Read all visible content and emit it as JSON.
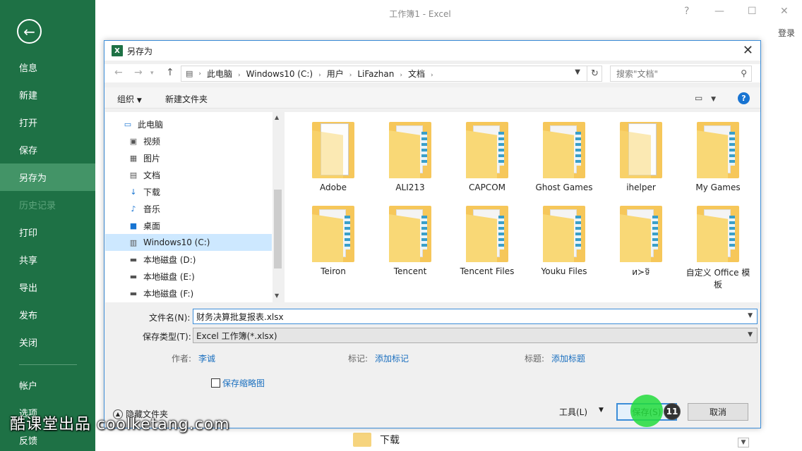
{
  "backstage": {
    "nav": [
      {
        "label": "信息",
        "state": "normal"
      },
      {
        "label": "新建",
        "state": "normal"
      },
      {
        "label": "打开",
        "state": "normal"
      },
      {
        "label": "保存",
        "state": "normal"
      },
      {
        "label": "另存为",
        "state": "active"
      },
      {
        "label": "历史记录",
        "state": "disabled"
      },
      {
        "label": "打印",
        "state": "normal"
      },
      {
        "label": "共享",
        "state": "normal"
      },
      {
        "label": "导出",
        "state": "normal"
      },
      {
        "label": "发布",
        "state": "normal"
      },
      {
        "label": "关闭",
        "state": "normal"
      },
      {
        "label": "帐户",
        "state": "normal"
      },
      {
        "label": "选项",
        "state": "normal"
      },
      {
        "label": "反馈",
        "state": "normal"
      }
    ],
    "window_title": "工作簿1 - Excel",
    "signin": "登录",
    "bg_folder_label": "下载"
  },
  "dialog": {
    "title": "另存为",
    "breadcrumb": [
      "此电脑",
      "Windows10 (C:)",
      "用户",
      "LiFazhan",
      "文档"
    ],
    "search_placeholder": "搜索\"文档\"",
    "toolbar": {
      "organize": "组织",
      "new_folder": "新建文件夹"
    },
    "nav_tree": [
      {
        "label": "此电脑",
        "icon": "computer-icon",
        "selected": false
      },
      {
        "label": "视频",
        "icon": "video-icon",
        "selected": false
      },
      {
        "label": "图片",
        "icon": "picture-icon",
        "selected": false
      },
      {
        "label": "文档",
        "icon": "document-icon",
        "selected": false
      },
      {
        "label": "下载",
        "icon": "download-icon",
        "selected": false
      },
      {
        "label": "音乐",
        "icon": "music-icon",
        "selected": false
      },
      {
        "label": "桌面",
        "icon": "desktop-icon",
        "selected": false
      },
      {
        "label": "Windows10 (C:)",
        "icon": "drive-icon",
        "selected": true
      },
      {
        "label": "本地磁盘 (D:)",
        "icon": "disk-icon",
        "selected": false
      },
      {
        "label": "本地磁盘 (E:)",
        "icon": "disk-icon",
        "selected": false
      },
      {
        "label": "本地磁盘 (F:)",
        "icon": "disk-icon",
        "selected": false
      }
    ],
    "files": [
      {
        "name": "Adobe",
        "type": "folder-doc"
      },
      {
        "name": "ALI213",
        "type": "folder"
      },
      {
        "name": "CAPCOM",
        "type": "folder"
      },
      {
        "name": "Ghost Games",
        "type": "folder"
      },
      {
        "name": "ihelper",
        "type": "folder-doc"
      },
      {
        "name": "My Games",
        "type": "folder"
      },
      {
        "name": "Teiron",
        "type": "folder"
      },
      {
        "name": "Tencent",
        "type": "folder"
      },
      {
        "name": "Tencent Files",
        "type": "folder"
      },
      {
        "name": "Youku Files",
        "type": "folder"
      },
      {
        "name": "и≻ទ៊",
        "type": "folder"
      },
      {
        "name": "自定义 Office 模板",
        "type": "folder"
      }
    ],
    "filename_label": "文件名(N):",
    "filename_value": "财务决算批复报表.xlsx",
    "filetype_label": "保存类型(T):",
    "filetype_value": "Excel 工作簿(*.xlsx)",
    "meta": {
      "author_label": "作者:",
      "author_value": "李诚",
      "tags_label": "标记:",
      "tags_value": "添加标记",
      "title_label": "标题:",
      "title_value": "添加标题"
    },
    "thumbnail_checkbox": "保存缩略图",
    "hide_folders": "隐藏文件夹",
    "tools": "工具(L)",
    "save": "保存(S)",
    "cancel": "取消"
  },
  "step_badge": "11",
  "watermark": "酷课堂出品 coolketang.com"
}
